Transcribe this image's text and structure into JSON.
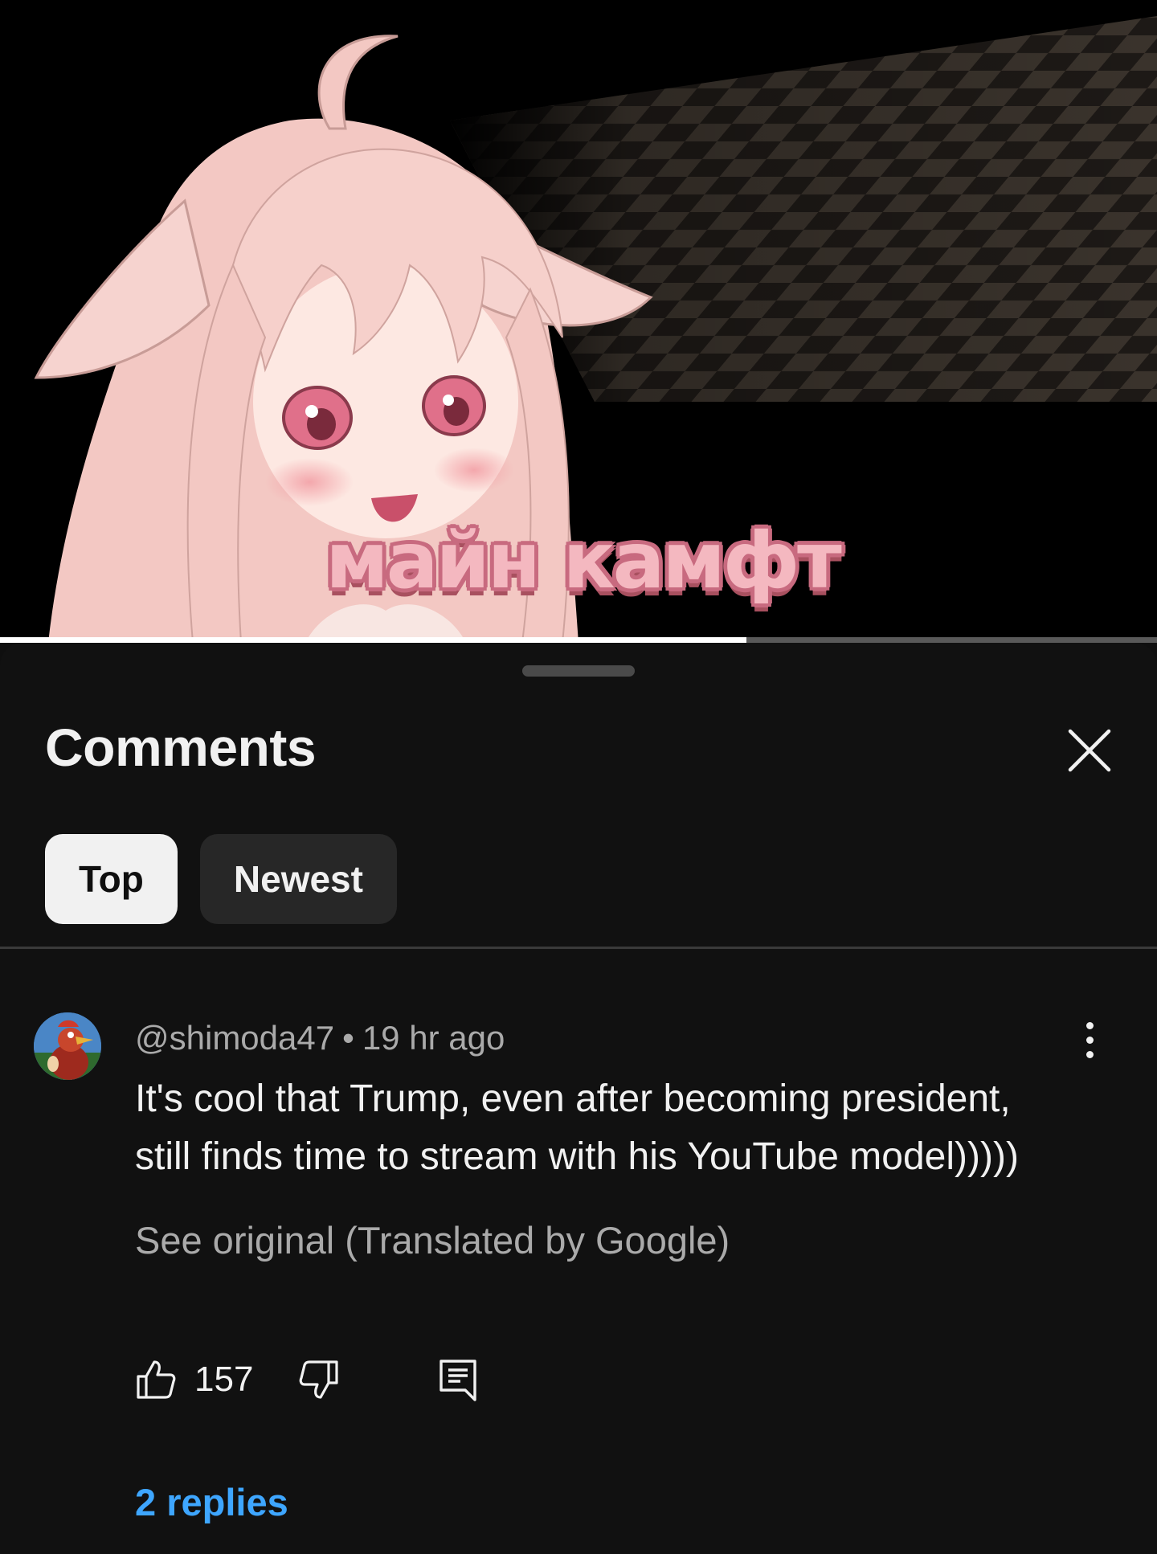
{
  "video": {
    "caption": "майн камфт",
    "progress_percent": 64.5
  },
  "comments_panel": {
    "title": "Comments",
    "sort_chips": [
      {
        "label": "Top",
        "selected": true
      },
      {
        "label": "Newest",
        "selected": false
      }
    ]
  },
  "comment": {
    "author": "@shimoda47",
    "separator": "•",
    "time": "19 hr ago",
    "text": "It's cool that Trump, even after becoming president, still finds time to stream with his YouTube model)))))",
    "translation_link": "See original (Translated by Google)",
    "like_count": "157",
    "replies_link": "2 replies"
  },
  "colors": {
    "background": "#0f0f0f",
    "sheet": "#111111",
    "link_blue": "#3ea6ff",
    "chip_selected": "#f1f1f1",
    "chip_unselected": "#272727",
    "caption_pink": "#f4b8c0"
  }
}
